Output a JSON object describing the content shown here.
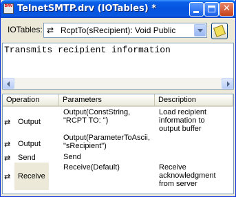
{
  "window": {
    "title": "TelnetSMTP.drv (IOTables)  *",
    "icon_text": "DRV",
    "buttons": {
      "minimize": "",
      "maximize": "",
      "close": "✕"
    }
  },
  "toolbar": {
    "iotables_label": "IOTables:",
    "combo_icon": "⇄",
    "combo_value": "RcptTo(sRecipient): Void Public"
  },
  "description": {
    "text": "Transmits recipient information"
  },
  "table": {
    "headers": {
      "operation": "Operation",
      "parameters": "Parameters",
      "description": "Description"
    },
    "rows": [
      {
        "icon": "⇄",
        "operation": "Output",
        "params": [
          "Output(ConstString,",
          "\"RCPT TO: \")"
        ],
        "desc": [
          "Load recipient",
          "information to",
          "output buffer"
        ]
      },
      {
        "icon": "⇄",
        "operation": "Output",
        "params": [
          "Output(ParameterToAscii,",
          "\"sRecipient\")"
        ],
        "desc": []
      },
      {
        "icon": "⇄",
        "operation": "Send",
        "params": [
          "Send"
        ],
        "desc": []
      },
      {
        "icon": "⇄",
        "operation": "Receive",
        "params": [
          "Receive(Default)"
        ],
        "desc": [
          "Receive",
          "acknowledgment",
          "from server"
        ],
        "selected": true
      }
    ]
  }
}
